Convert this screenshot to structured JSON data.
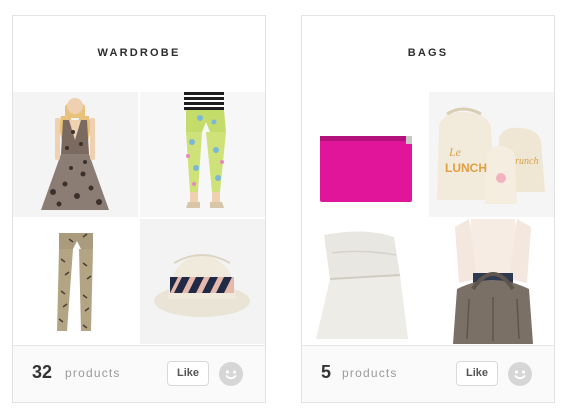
{
  "collections": [
    {
      "title": "WARDROBE",
      "count": "32",
      "count_label": "products",
      "like_label": "Like",
      "items": [
        {
          "name": "leopard-print-dress"
        },
        {
          "name": "floral-print-pants"
        },
        {
          "name": "printed-leggings"
        },
        {
          "name": "striped-fedora-hat"
        }
      ]
    },
    {
      "title": "BAGS",
      "count": "5",
      "count_label": "products",
      "like_label": "Like",
      "items": [
        {
          "name": "pink-clutch"
        },
        {
          "name": "canvas-lunch-bags"
        },
        {
          "name": "white-leather-clutch"
        },
        {
          "name": "grey-tote-bag"
        }
      ]
    }
  ],
  "colors": {
    "border": "#e2e2e2",
    "footer_bg": "#fafafa",
    "smiley": "#d6d6d6",
    "title_text": "#2e2e2e",
    "clutch_pink": "#e0159a"
  }
}
